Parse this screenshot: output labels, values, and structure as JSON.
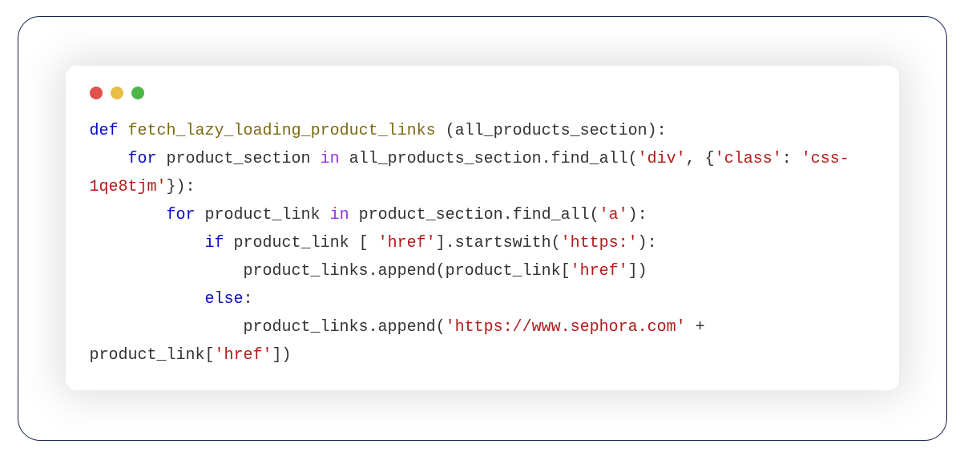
{
  "traffic_lights": {
    "red": "#e0524d",
    "yellow": "#e7bd47",
    "green": "#4cb649"
  },
  "code": {
    "l1_kw": "def",
    "l1_fn": "fetch_lazy_loading_product_links",
    "l1_rest": " (all_products_section):",
    "l2_indent": "    ",
    "l2_kw": "for",
    "l2_a": " product_section ",
    "l2_op": "in",
    "l2_b": " all_products_section.find_all(",
    "l2_s1": "'div'",
    "l2_c": ", {",
    "l2_s2": "'class'",
    "l2_d": ": ",
    "l2_s3": "'css-1qe8tjm'",
    "l2_e": "}):",
    "l3_indent": "        ",
    "l3_kw": "for",
    "l3_a": " product_link ",
    "l3_op": "in",
    "l3_b": " product_section.find_all(",
    "l3_s1": "'a'",
    "l3_c": "):",
    "l4_indent": "            ",
    "l4_kw": "if",
    "l4_a": " product_link [ ",
    "l4_s1": "'href'",
    "l4_b": "].startswith(",
    "l4_s2": "'https:'",
    "l4_c": "):",
    "l5_indent": "                ",
    "l5_a": "product_links.append(product_link[",
    "l5_s1": "'href'",
    "l5_b": "])",
    "l6_indent": "            ",
    "l6_kw": "else",
    "l6_a": ":",
    "l7_indent": "                ",
    "l7_a": "product_links.append(",
    "l7_s1": "'https://www.sephora.com'",
    "l7_b": " + product_link[",
    "l7_s2": "'href'",
    "l7_c": "])"
  }
}
